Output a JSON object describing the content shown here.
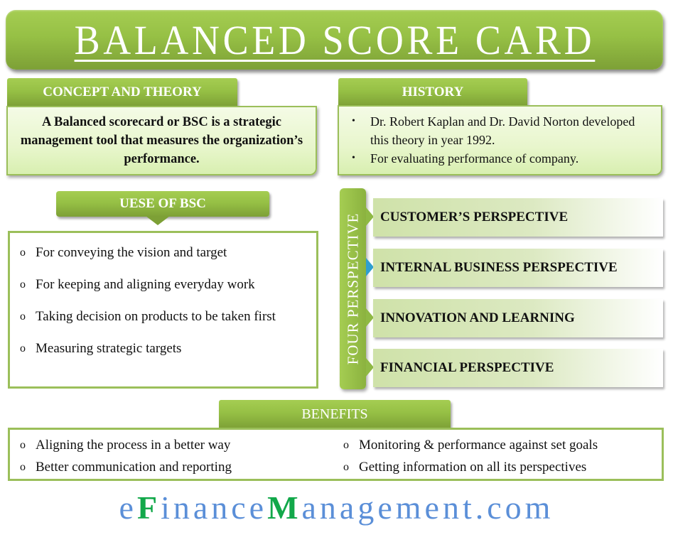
{
  "title": "BALANCED SCORE CARD",
  "colors": {
    "primary_green": "#96c045",
    "dark_green": "#7da036",
    "light_green_box": "#e8f6cc",
    "border_green": "#9bbf5a",
    "active_arrow_blue": "#2f9fd0",
    "brand_blue": "#5b8fd8",
    "brand_green": "#12a84a"
  },
  "concept": {
    "heading": "CONCEPT AND THEORY",
    "text": "A Balanced scorecard or BSC is a strategic management tool that measures the organization’s performance."
  },
  "history": {
    "heading": "HISTORY",
    "bullet_icon": "•",
    "items": [
      "Dr. Robert Kaplan and Dr. David Norton developed this theory in year 1992.",
      "For evaluating performance of company."
    ]
  },
  "uses": {
    "heading": "UESE OF BSC",
    "bullet_icon": "o",
    "items": [
      "For conveying the vision and target",
      "For keeping and aligning everyday work",
      "Taking decision on products to be taken first",
      "Measuring strategic targets"
    ]
  },
  "perspectives": {
    "label": "FOUR PERSPECTIVE",
    "items": [
      {
        "label": "CUSTOMER’S PERSPECTIVE",
        "active": false
      },
      {
        "label": "INTERNAL BUSINESS PERSPECTIVE",
        "active": true
      },
      {
        "label": "INNOVATION AND LEARNING",
        "active": false
      },
      {
        "label": "FINANCIAL PERSPECTIVE",
        "active": false
      }
    ]
  },
  "benefits": {
    "heading": "BENEFITS",
    "bullet_icon": "o",
    "items": [
      "Aligning the process in a better way",
      "Monitoring & performance against set goals",
      "Better communication and reporting",
      "Getting information on all its perspectives"
    ]
  },
  "brand": {
    "parts": [
      "e",
      "F",
      "inance",
      "M",
      "anagement.com"
    ]
  }
}
